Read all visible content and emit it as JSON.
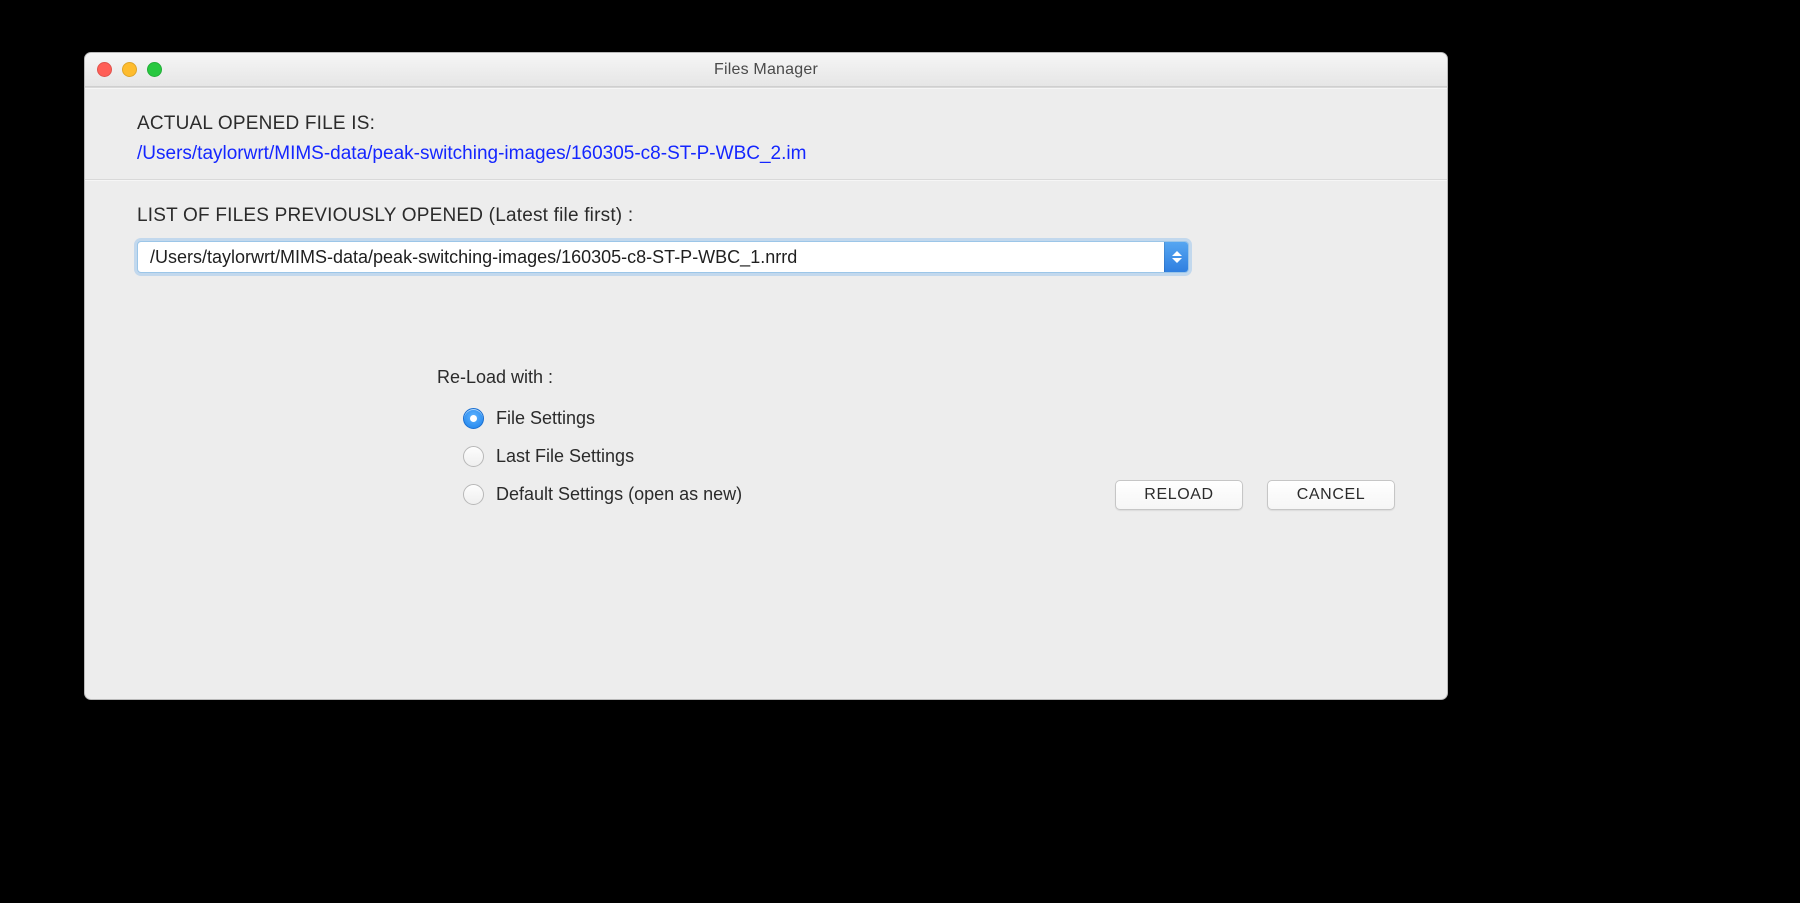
{
  "window": {
    "title": "Files Manager"
  },
  "opened_file": {
    "heading": "ACTUAL OPENED FILE IS:",
    "path": "/Users/taylorwrt/MIMS-data/peak-switching-images/160305-c8-ST-P-WBC_2.im"
  },
  "previous_files": {
    "heading": "LIST OF FILES PREVIOUSLY OPENED (Latest file first) :",
    "selected": "/Users/taylorwrt/MIMS-data/peak-switching-images/160305-c8-ST-P-WBC_1.nrrd"
  },
  "reload": {
    "group_label": "Re-Load with :",
    "options": [
      {
        "label": "File Settings",
        "selected": true
      },
      {
        "label": "Last File Settings",
        "selected": false
      },
      {
        "label": "Default Settings (open as new)",
        "selected": false
      }
    ],
    "reload_button": "RELOAD",
    "cancel_button": "CANCEL"
  }
}
